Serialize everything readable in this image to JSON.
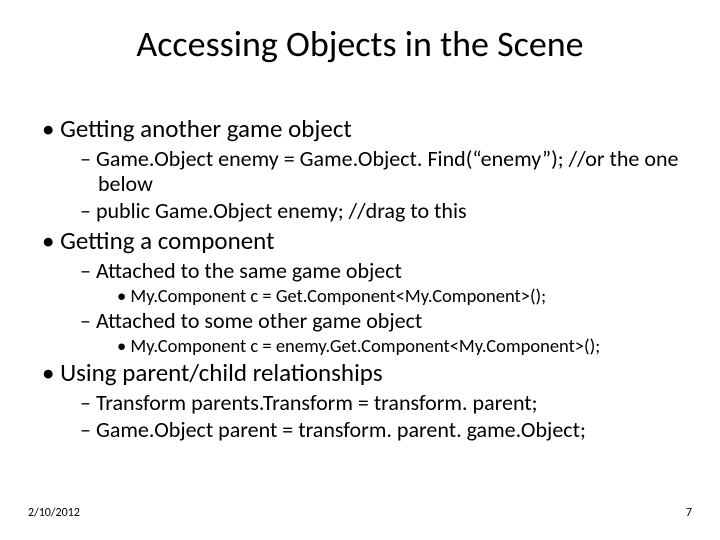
{
  "title": "Accessing Objects in the Scene",
  "bullets": {
    "b1": "Getting another game object",
    "b1_1": "Game.Object enemy = Game.Object. Find(“enemy”); //or the one below",
    "b1_2": "public Game.Object enemy; //drag to this",
    "b2": "Getting a component",
    "b2_1": "Attached to the same game object",
    "b2_1_1": "My.Component c = Get.Component<My.Component>();",
    "b2_2": "Attached to some other game object",
    "b2_2_1": "My.Component c = enemy.Get.Component<My.Component>();",
    "b3": "Using parent/child relationships",
    "b3_1": "Transform parents.Transform = transform. parent;",
    "b3_2": "Game.Object parent = transform. parent. game.Object;"
  },
  "footer": {
    "date": "2/10/2012",
    "page": "7"
  }
}
